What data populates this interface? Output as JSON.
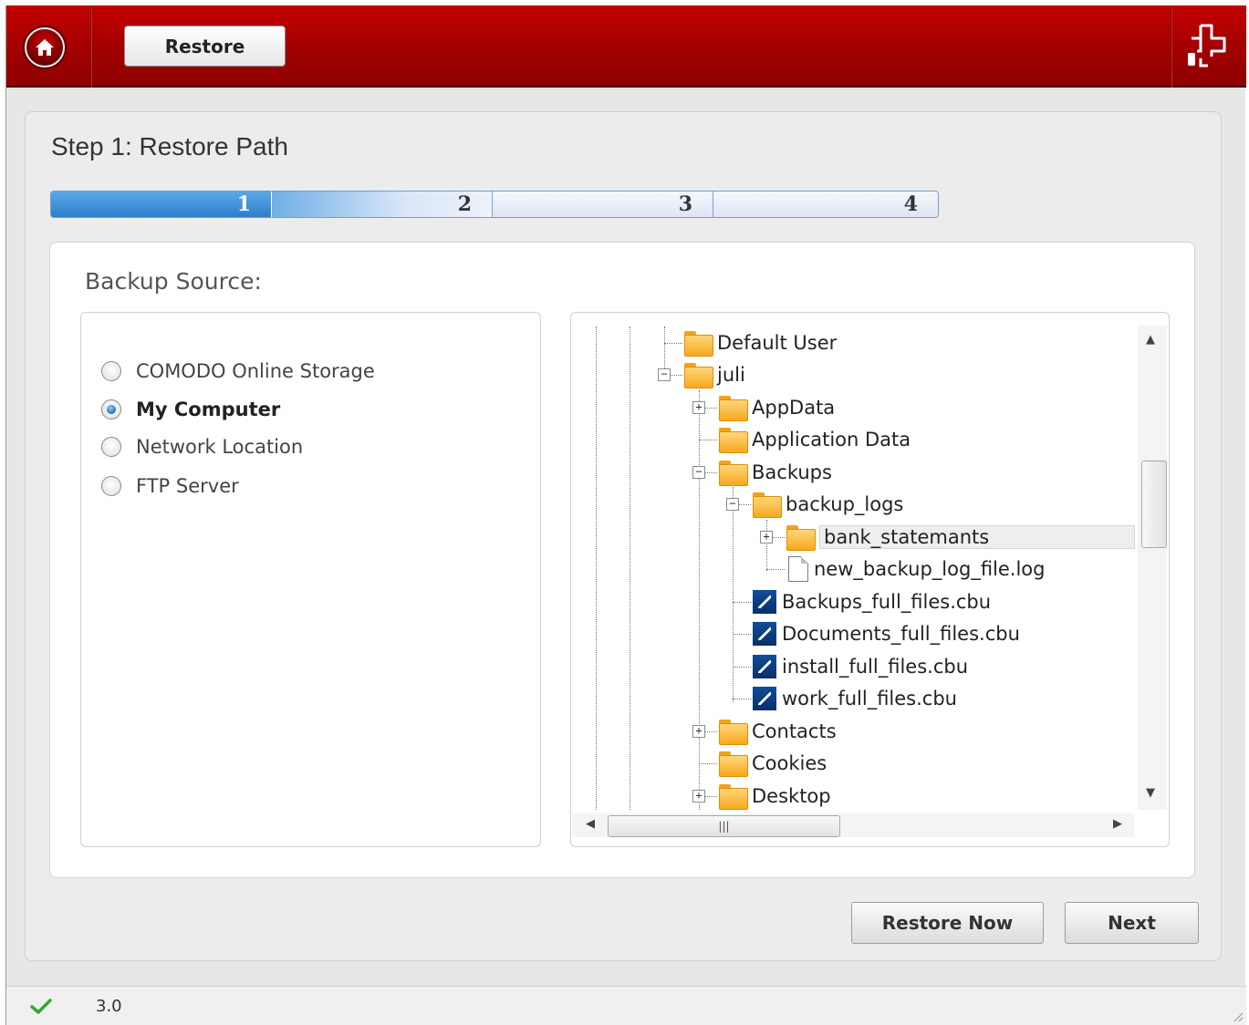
{
  "header": {
    "tab_label": "Restore",
    "colors": {
      "bar": "#a80000",
      "accent": "#2d7fcb"
    }
  },
  "step": {
    "title": "Step 1: Restore Path",
    "progress_steps": [
      "1",
      "2",
      "3",
      "4"
    ],
    "current_step": 1
  },
  "backup_source": {
    "label": "Backup Source:",
    "options": [
      {
        "label": "COMODO Online Storage",
        "selected": false
      },
      {
        "label": "My Computer",
        "selected": true
      },
      {
        "label": "Network Location",
        "selected": false
      },
      {
        "label": "FTP Server",
        "selected": false
      }
    ]
  },
  "tree": {
    "items": [
      {
        "label": "Default User",
        "icon": "folder-icon"
      },
      {
        "label": "juli",
        "icon": "folder-icon",
        "expanded": true
      },
      {
        "label": "AppData",
        "icon": "folder-icon",
        "expanded": false
      },
      {
        "label": "Application Data",
        "icon": "folder-icon"
      },
      {
        "label": "Backups",
        "icon": "folder-icon",
        "expanded": true
      },
      {
        "label": "backup_logs",
        "icon": "folder-icon",
        "expanded": true
      },
      {
        "label": "bank_statemants",
        "icon": "folder-icon",
        "expanded": false,
        "selected": true
      },
      {
        "label": "new_backup_log_file.log",
        "icon": "file-icon"
      },
      {
        "label": "Backups_full_files.cbu",
        "icon": "cbu-file-icon"
      },
      {
        "label": "Documents_full_files.cbu",
        "icon": "cbu-file-icon"
      },
      {
        "label": "install_full_files.cbu",
        "icon": "cbu-file-icon"
      },
      {
        "label": "work_full_files.cbu",
        "icon": "cbu-file-icon"
      },
      {
        "label": "Contacts",
        "icon": "folder-icon",
        "expanded": false
      },
      {
        "label": "Cookies",
        "icon": "folder-icon"
      },
      {
        "label": "Desktop",
        "icon": "folder-icon",
        "expanded": false
      }
    ]
  },
  "buttons": {
    "restore_now": "Restore Now",
    "next": "Next"
  },
  "status": {
    "version": "3.0"
  }
}
